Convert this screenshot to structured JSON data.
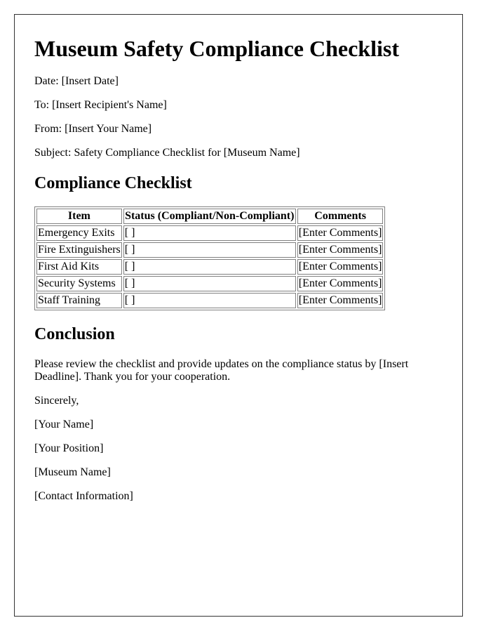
{
  "document": {
    "title": "Museum Safety Compliance Checklist",
    "header_fields": [
      "Date: [Insert Date]",
      "To: [Insert Recipient's Name]",
      "From: [Insert Your Name]",
      "Subject: Safety Compliance Checklist for [Museum Name]"
    ],
    "checklist_heading": "Compliance Checklist",
    "table": {
      "headers": [
        "Item",
        "Status (Compliant/Non-Compliant)",
        "Comments"
      ],
      "rows": [
        [
          "Emergency Exits",
          "[ ]",
          "[Enter Comments]"
        ],
        [
          "Fire Extinguishers",
          "[ ]",
          "[Enter Comments]"
        ],
        [
          "First Aid Kits",
          "[ ]",
          "[Enter Comments]"
        ],
        [
          "Security Systems",
          "[ ]",
          "[Enter Comments]"
        ],
        [
          "Staff Training",
          "[ ]",
          "[Enter Comments]"
        ]
      ]
    },
    "conclusion_heading": "Conclusion",
    "conclusion_text": "Please review the checklist and provide updates on the compliance status by [Insert Deadline]. Thank you for your cooperation.",
    "signoff": [
      "Sincerely,",
      "[Your Name]",
      "[Your Position]",
      "[Museum Name]",
      "[Contact Information]"
    ]
  }
}
